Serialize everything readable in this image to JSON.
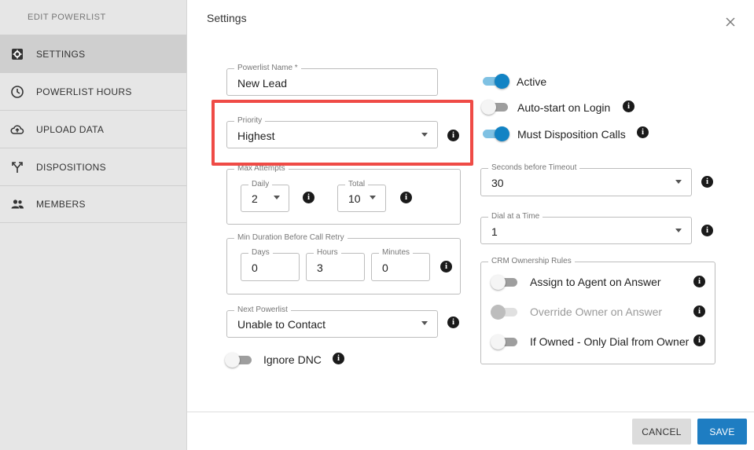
{
  "sidebar": {
    "title": "EDIT POWERLIST",
    "items": [
      {
        "label": "SETTINGS",
        "icon": "settings-gear-icon"
      },
      {
        "label": "POWERLIST HOURS",
        "icon": "clock-icon"
      },
      {
        "label": "UPLOAD DATA",
        "icon": "cloud-upload-icon"
      },
      {
        "label": "DISPOSITIONS",
        "icon": "fork-arrow-icon"
      },
      {
        "label": "MEMBERS",
        "icon": "people-icon"
      }
    ]
  },
  "header": {
    "title": "Settings"
  },
  "form": {
    "powerlist_name": {
      "label": "Powerlist Name *",
      "value": "New Lead"
    },
    "priority": {
      "label": "Priority",
      "value": "Highest"
    },
    "max_attempts": {
      "label": "Max Attempts",
      "daily": {
        "label": "Daily",
        "value": "2"
      },
      "total": {
        "label": "Total",
        "value": "10"
      }
    },
    "min_duration": {
      "label": "Min Duration Before Call Retry",
      "days": {
        "label": "Days",
        "value": "0"
      },
      "hours": {
        "label": "Hours",
        "value": "3"
      },
      "minutes": {
        "label": "Minutes",
        "value": "0"
      }
    },
    "next_powerlist": {
      "label": "Next Powerlist",
      "value": "Unable to Contact"
    },
    "ignore_dnc": {
      "label": "Ignore DNC",
      "on": false
    },
    "active": {
      "label": "Active",
      "on": true
    },
    "auto_start": {
      "label": "Auto-start on Login",
      "on": false
    },
    "must_disposition": {
      "label": "Must Disposition Calls",
      "on": true
    },
    "seconds_timeout": {
      "label": "Seconds before Timeout",
      "value": "30"
    },
    "dial_at_time": {
      "label": "Dial at a Time",
      "value": "1"
    },
    "crm_rules": {
      "label": "CRM Ownership Rules",
      "assign_agent": {
        "label": "Assign to Agent on Answer",
        "on": false
      },
      "override_owner": {
        "label": "Override Owner on Answer",
        "on": false,
        "disabled": true
      },
      "if_owned": {
        "label": "If Owned - Only Dial from Owner",
        "on": false
      }
    }
  },
  "info_glyph": "i",
  "footer": {
    "cancel_label": "CANCEL",
    "save_label": "SAVE"
  },
  "colors": {
    "accent": "#1283c4",
    "save": "#1e7dc2",
    "highlight": "#ef4b46"
  }
}
